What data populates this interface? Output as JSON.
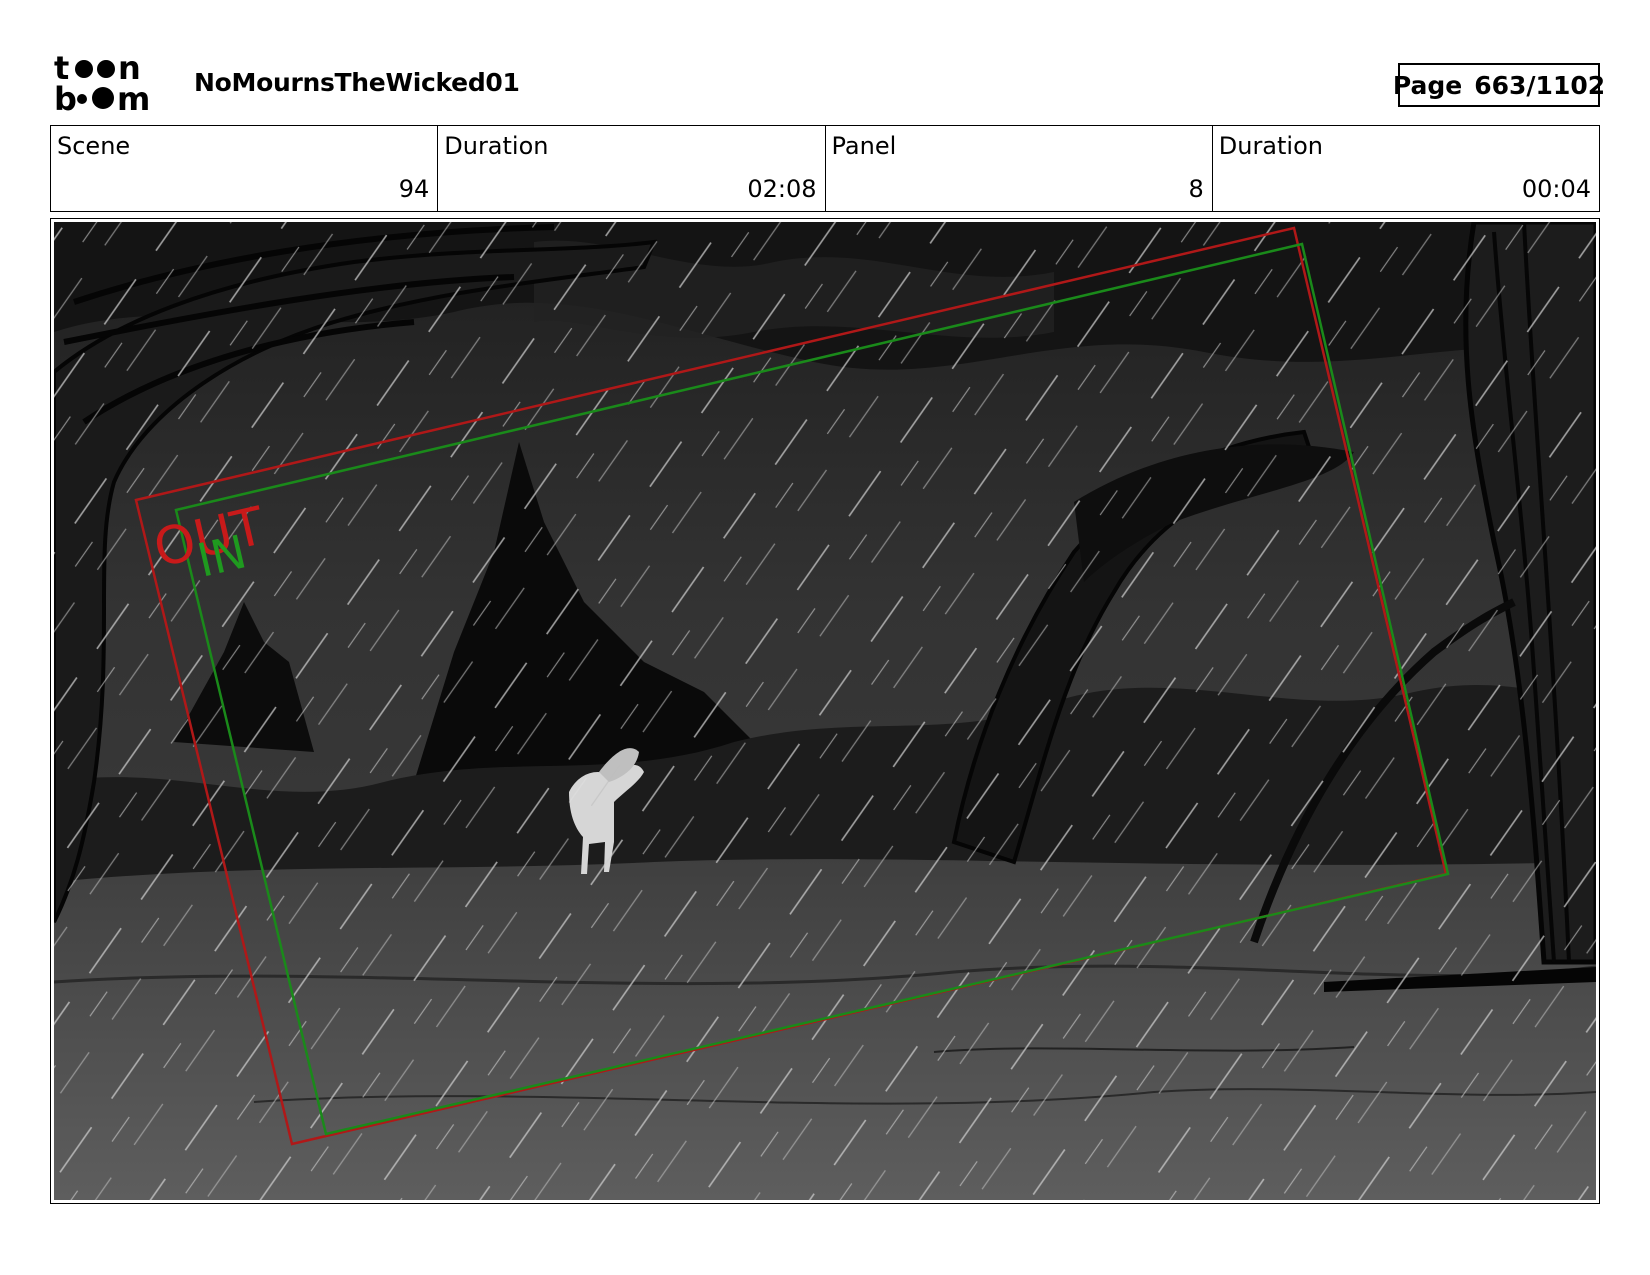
{
  "header": {
    "logo_text_top": "toon",
    "logo_text_bottom": "boom",
    "project_name": "NoMournsTheWicked01",
    "page_label": "Page",
    "page_value": "663/1102"
  },
  "info": [
    {
      "label": "Scene",
      "value": "94"
    },
    {
      "label": "Duration",
      "value": "02:08"
    },
    {
      "label": "Panel",
      "value": "8"
    },
    {
      "label": "Duration",
      "value": "00:04"
    }
  ],
  "panel": {
    "out_label": "OUT",
    "in_label": "IN",
    "colors": {
      "out_frame": "#b01818",
      "in_frame": "#1a8a1a",
      "sky": "#2a2a2a",
      "ground": "#555555",
      "rain": "#d8d8d8"
    }
  }
}
